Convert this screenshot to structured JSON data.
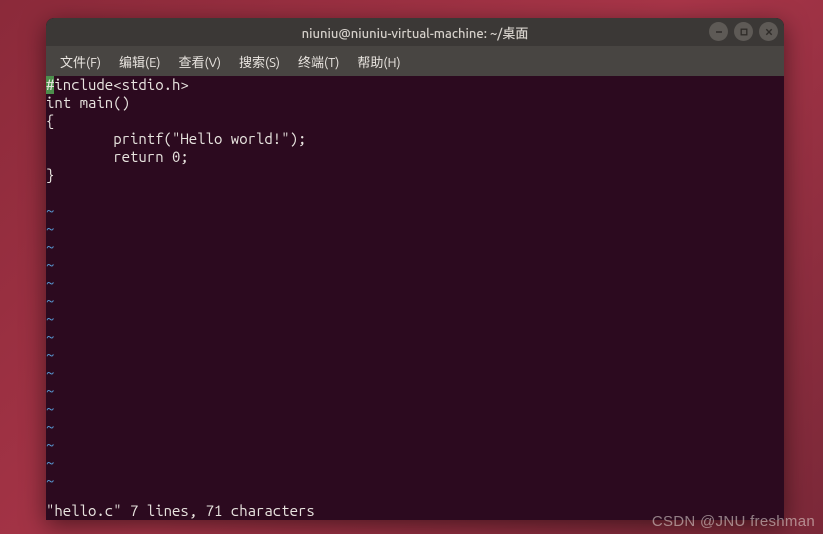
{
  "window": {
    "title": "niuniu@niuniu-virtual-machine: ~/桌面"
  },
  "menu": {
    "file": "文件(F)",
    "edit": "编辑(E)",
    "view": "查看(V)",
    "search": "搜索(S)",
    "terminal": "终端(T)",
    "help": "帮助(H)"
  },
  "code": {
    "cursor_char": "#",
    "l1_rest": "include<stdio.h>",
    "l2": "int main()",
    "l3": "{",
    "l4": "        printf(\"Hello world!\");",
    "l5": "        return 0;",
    "l6": "}",
    "l7": ""
  },
  "tilde": "~",
  "status": "\"hello.c\" 7 lines, 71 characters",
  "watermark": "CSDN @JNU freshman",
  "icons": {
    "minimize": "minimize-icon",
    "maximize": "maximize-icon",
    "close": "close-icon"
  }
}
